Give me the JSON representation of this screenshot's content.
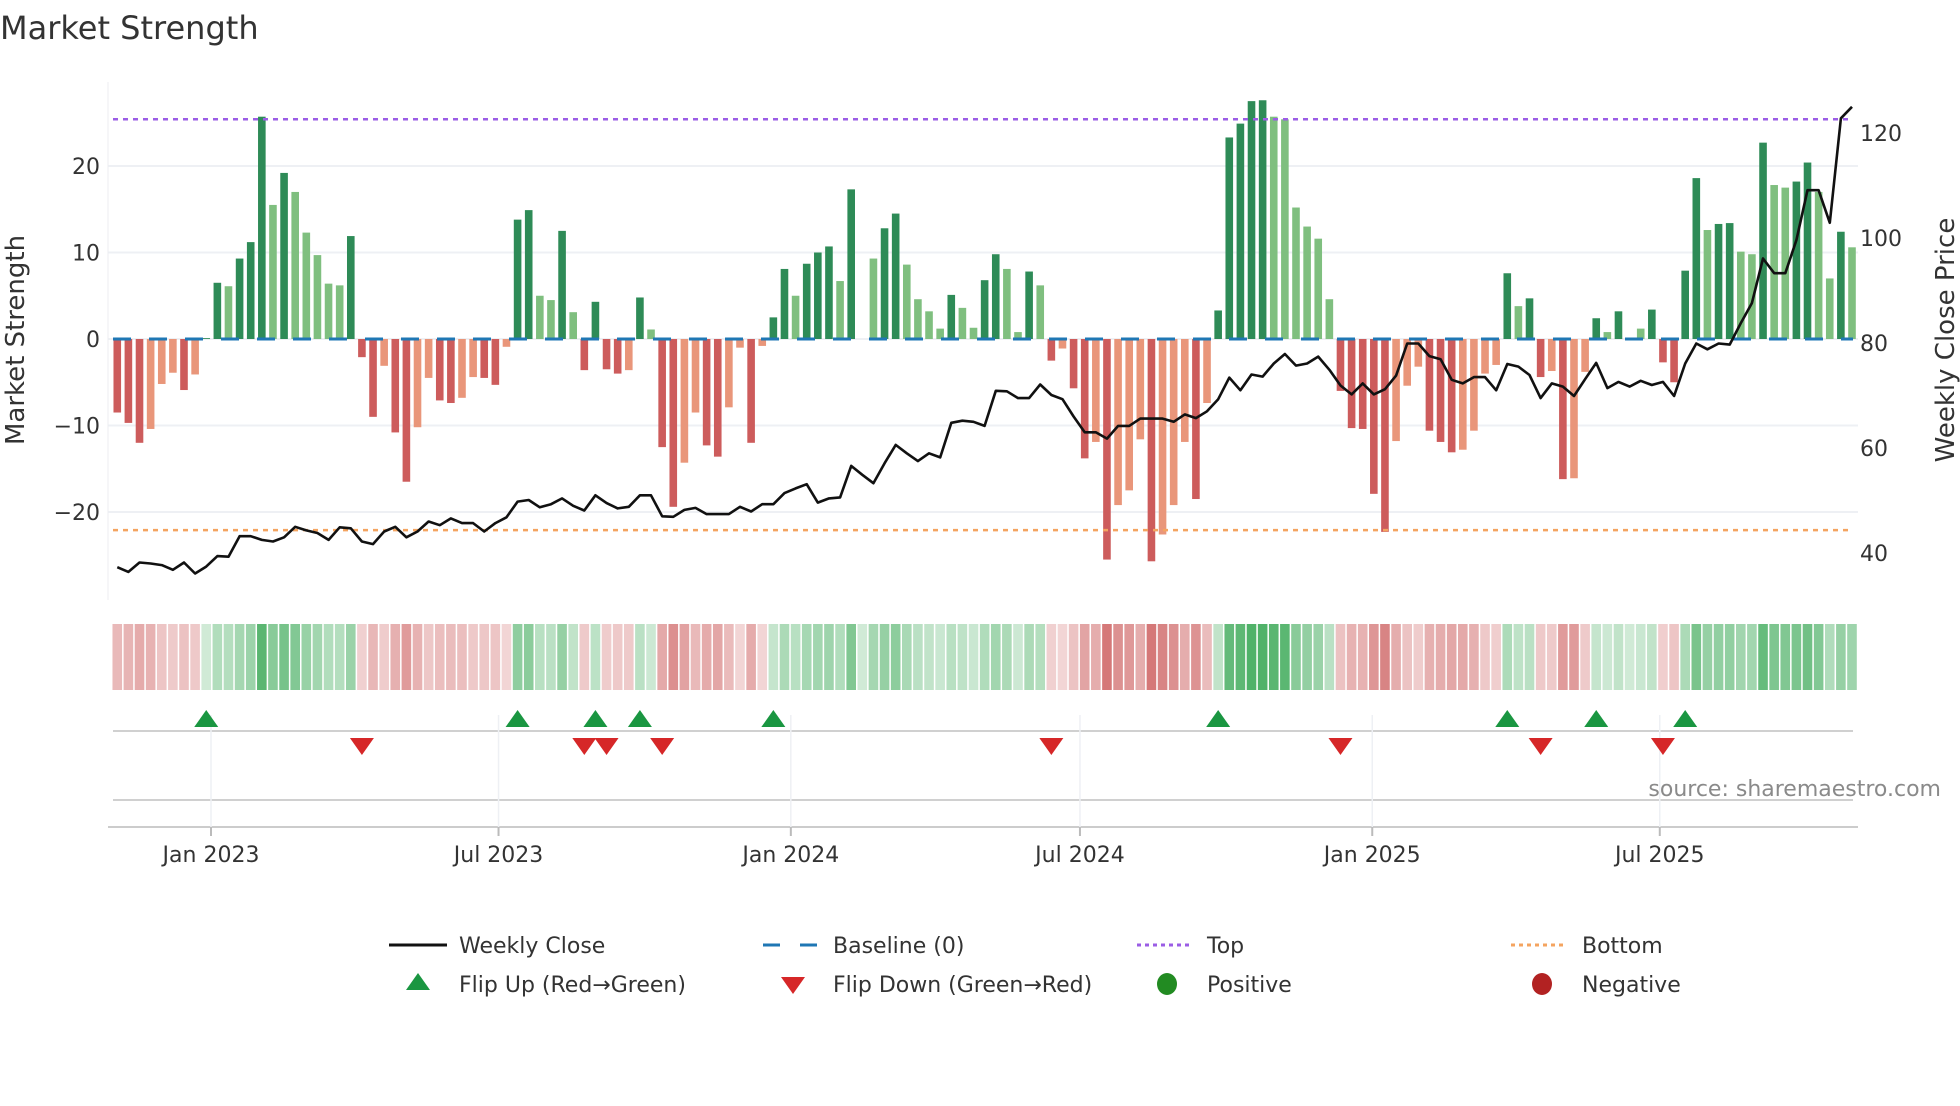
{
  "chart_data": {
    "type": "bar",
    "title": "Market Strength",
    "ylabel": "Market Strength",
    "y2label": "Weekly Close Price",
    "x_start": "2022-11-03",
    "x_freq": "weekly",
    "ylim": [
      -28,
      28.5
    ],
    "y2lim": [
      30,
      128
    ],
    "yticks": [
      20,
      10,
      0,
      -10,
      -20
    ],
    "ytick_labels": [
      "20",
      "10",
      "0",
      "−10",
      "−20"
    ],
    "y2ticks": [
      120,
      100,
      80,
      60,
      40
    ],
    "y2tick_labels": [
      "120",
      "100",
      "80",
      "60",
      "40"
    ],
    "xticks": [
      "2023-01-01",
      "2023-07-01",
      "2024-01-01",
      "2024-07-01",
      "2025-01-01",
      "2025-07-01"
    ],
    "xtick_labels": [
      "Jan 2023",
      "Jul 2023",
      "Jan 2024",
      "Jul 2024",
      "Jan 2025",
      "Jul 2025"
    ],
    "top_level": 25.4,
    "bottom_level": -22.1,
    "baseline": 0,
    "strength": [
      -8.5,
      -9.7,
      -12.0,
      -10.4,
      -5.2,
      -3.9,
      -5.9,
      -4.1,
      0.1,
      6.5,
      6.1,
      9.3,
      11.2,
      25.7,
      15.5,
      19.2,
      17.0,
      12.3,
      9.7,
      6.4,
      6.2,
      11.9,
      -2.1,
      -9.0,
      -3.1,
      -10.8,
      -16.5,
      -10.2,
      -4.5,
      -7.1,
      -7.4,
      -6.8,
      -4.4,
      -4.5,
      -5.3,
      -0.9,
      13.8,
      14.9,
      5.0,
      4.5,
      12.5,
      3.1,
      -3.6,
      4.3,
      -3.5,
      -4.0,
      -3.6,
      4.8,
      1.1,
      -12.5,
      -19.4,
      -14.3,
      -8.5,
      -12.3,
      -13.6,
      -7.9,
      -1.0,
      -12.0,
      -0.8,
      2.5,
      8.1,
      5.0,
      8.7,
      10.0,
      10.7,
      6.7,
      17.3,
      0,
      9.3,
      12.8,
      14.5,
      8.6,
      4.6,
      3.2,
      1.2,
      5.1,
      3.6,
      1.3,
      6.8,
      9.8,
      8.1,
      0.8,
      7.8,
      6.2,
      -2.5,
      -1.1,
      -5.7,
      -13.8,
      -11.9,
      -25.5,
      -19.2,
      -17.5,
      -11.6,
      -25.7,
      -22.6,
      -19.2,
      -11.9,
      -18.5,
      -7.4,
      3.3,
      23.3,
      24.9,
      27.5,
      27.6,
      25.7,
      25.4,
      15.2,
      13.0,
      11.6,
      4.6,
      -6.0,
      -10.3,
      -10.4,
      -17.9,
      -22.3,
      -11.8,
      -5.4,
      -3.2,
      -10.6,
      -11.9,
      -13.1,
      -12.8,
      -10.6,
      -4.0,
      -3.0,
      7.6,
      3.8,
      4.7,
      -4.4,
      -3.7,
      -16.2,
      -16.1,
      -3.8,
      2.4,
      0.8,
      3.2,
      0,
      1.2,
      3.4,
      -2.7,
      -5.0,
      7.9,
      18.6,
      12.6,
      13.3,
      13.4,
      10.1,
      9.8,
      22.7,
      17.8,
      17.5,
      18.2,
      20.4,
      17.0,
      7.0,
      12.4,
      10.6
    ],
    "weekly_close": [
      37.3,
      36.4,
      38.2,
      38.0,
      37.7,
      36.8,
      38.2,
      36.1,
      37.4,
      39.4,
      39.3,
      43.2,
      43.2,
      42.5,
      42.2,
      43.0,
      45.0,
      44.3,
      43.8,
      42.5,
      44.9,
      44.7,
      42.2,
      41.7,
      44.1,
      45.0,
      43.0,
      44.1,
      46.0,
      45.3,
      46.6,
      45.7,
      45.7,
      44.1,
      45.7,
      46.8,
      49.8,
      50.1,
      48.7,
      49.3,
      50.4,
      49.0,
      48.1,
      51.0,
      49.5,
      48.5,
      48.8,
      51.0,
      51.0,
      47.0,
      46.9,
      48.2,
      48.6,
      47.4,
      47.4,
      47.4,
      48.8,
      47.9,
      49.3,
      49.3,
      51.4,
      52.3,
      53.1,
      49.6,
      50.4,
      50.6,
      56.6,
      54.9,
      53.3,
      57.1,
      60.6,
      59.0,
      57.5,
      59.0,
      58.2,
      64.8,
      65.2,
      65.0,
      64.2,
      70.9,
      70.8,
      69.5,
      69.5,
      72.1,
      70.1,
      69.3,
      66.0,
      63.0,
      63.0,
      61.8,
      64.2,
      64.2,
      65.6,
      65.6,
      65.6,
      65.0,
      66.4,
      65.7,
      67.0,
      69.3,
      73.4,
      71.0,
      74.0,
      73.6,
      76.1,
      77.9,
      75.7,
      76.1,
      77.4,
      74.9,
      71.9,
      70.2,
      72.3,
      70.2,
      71.2,
      73.8,
      79.9,
      79.9,
      77.5,
      76.9,
      73.0,
      72.3,
      73.5,
      73.5,
      71.0,
      76.0,
      75.5,
      73.9,
      69.5,
      72.3,
      71.7,
      69.9,
      73.1,
      76.2,
      71.4,
      72.6,
      71.7,
      72.8,
      72.0,
      72.6,
      69.9,
      76.1,
      79.9,
      78.8,
      79.9,
      79.7,
      83.8,
      87.6,
      96.1,
      93.3,
      93.3,
      99.6,
      109.1,
      109.1,
      102.9,
      122.8,
      125.0
    ],
    "legend": {
      "placement": "bottom",
      "entries": [
        {
          "label": "Weekly Close",
          "symbol": "line"
        },
        {
          "label": "Baseline (0)",
          "symbol": "dash"
        },
        {
          "label": "Top",
          "symbol": "dot"
        },
        {
          "label": "Bottom",
          "symbol": "dot"
        },
        {
          "label": "Flip Up (Red→Green)",
          "symbol": "triangle-up"
        },
        {
          "label": "Flip Down (Green→Red)",
          "symbol": "triangle-down"
        },
        {
          "label": "Positive",
          "symbol": "circle"
        },
        {
          "label": "Negative",
          "symbol": "circle"
        }
      ]
    },
    "grid": true
  },
  "source_note": "source: sharemaestro.com",
  "colors": {
    "pos_strong": "#2e8b57",
    "pos_weak": "#7fbf7f",
    "neg_strong": "#cd5c5c",
    "neg_weak": "#e9967a",
    "line": "#111111",
    "baseline": "#1f77b4",
    "top": "#9b5de5",
    "bottom": "#f4a460",
    "flip_up": "#1a9641",
    "flip_down": "#d62728",
    "positive": "#228b22",
    "negative": "#b22222"
  }
}
